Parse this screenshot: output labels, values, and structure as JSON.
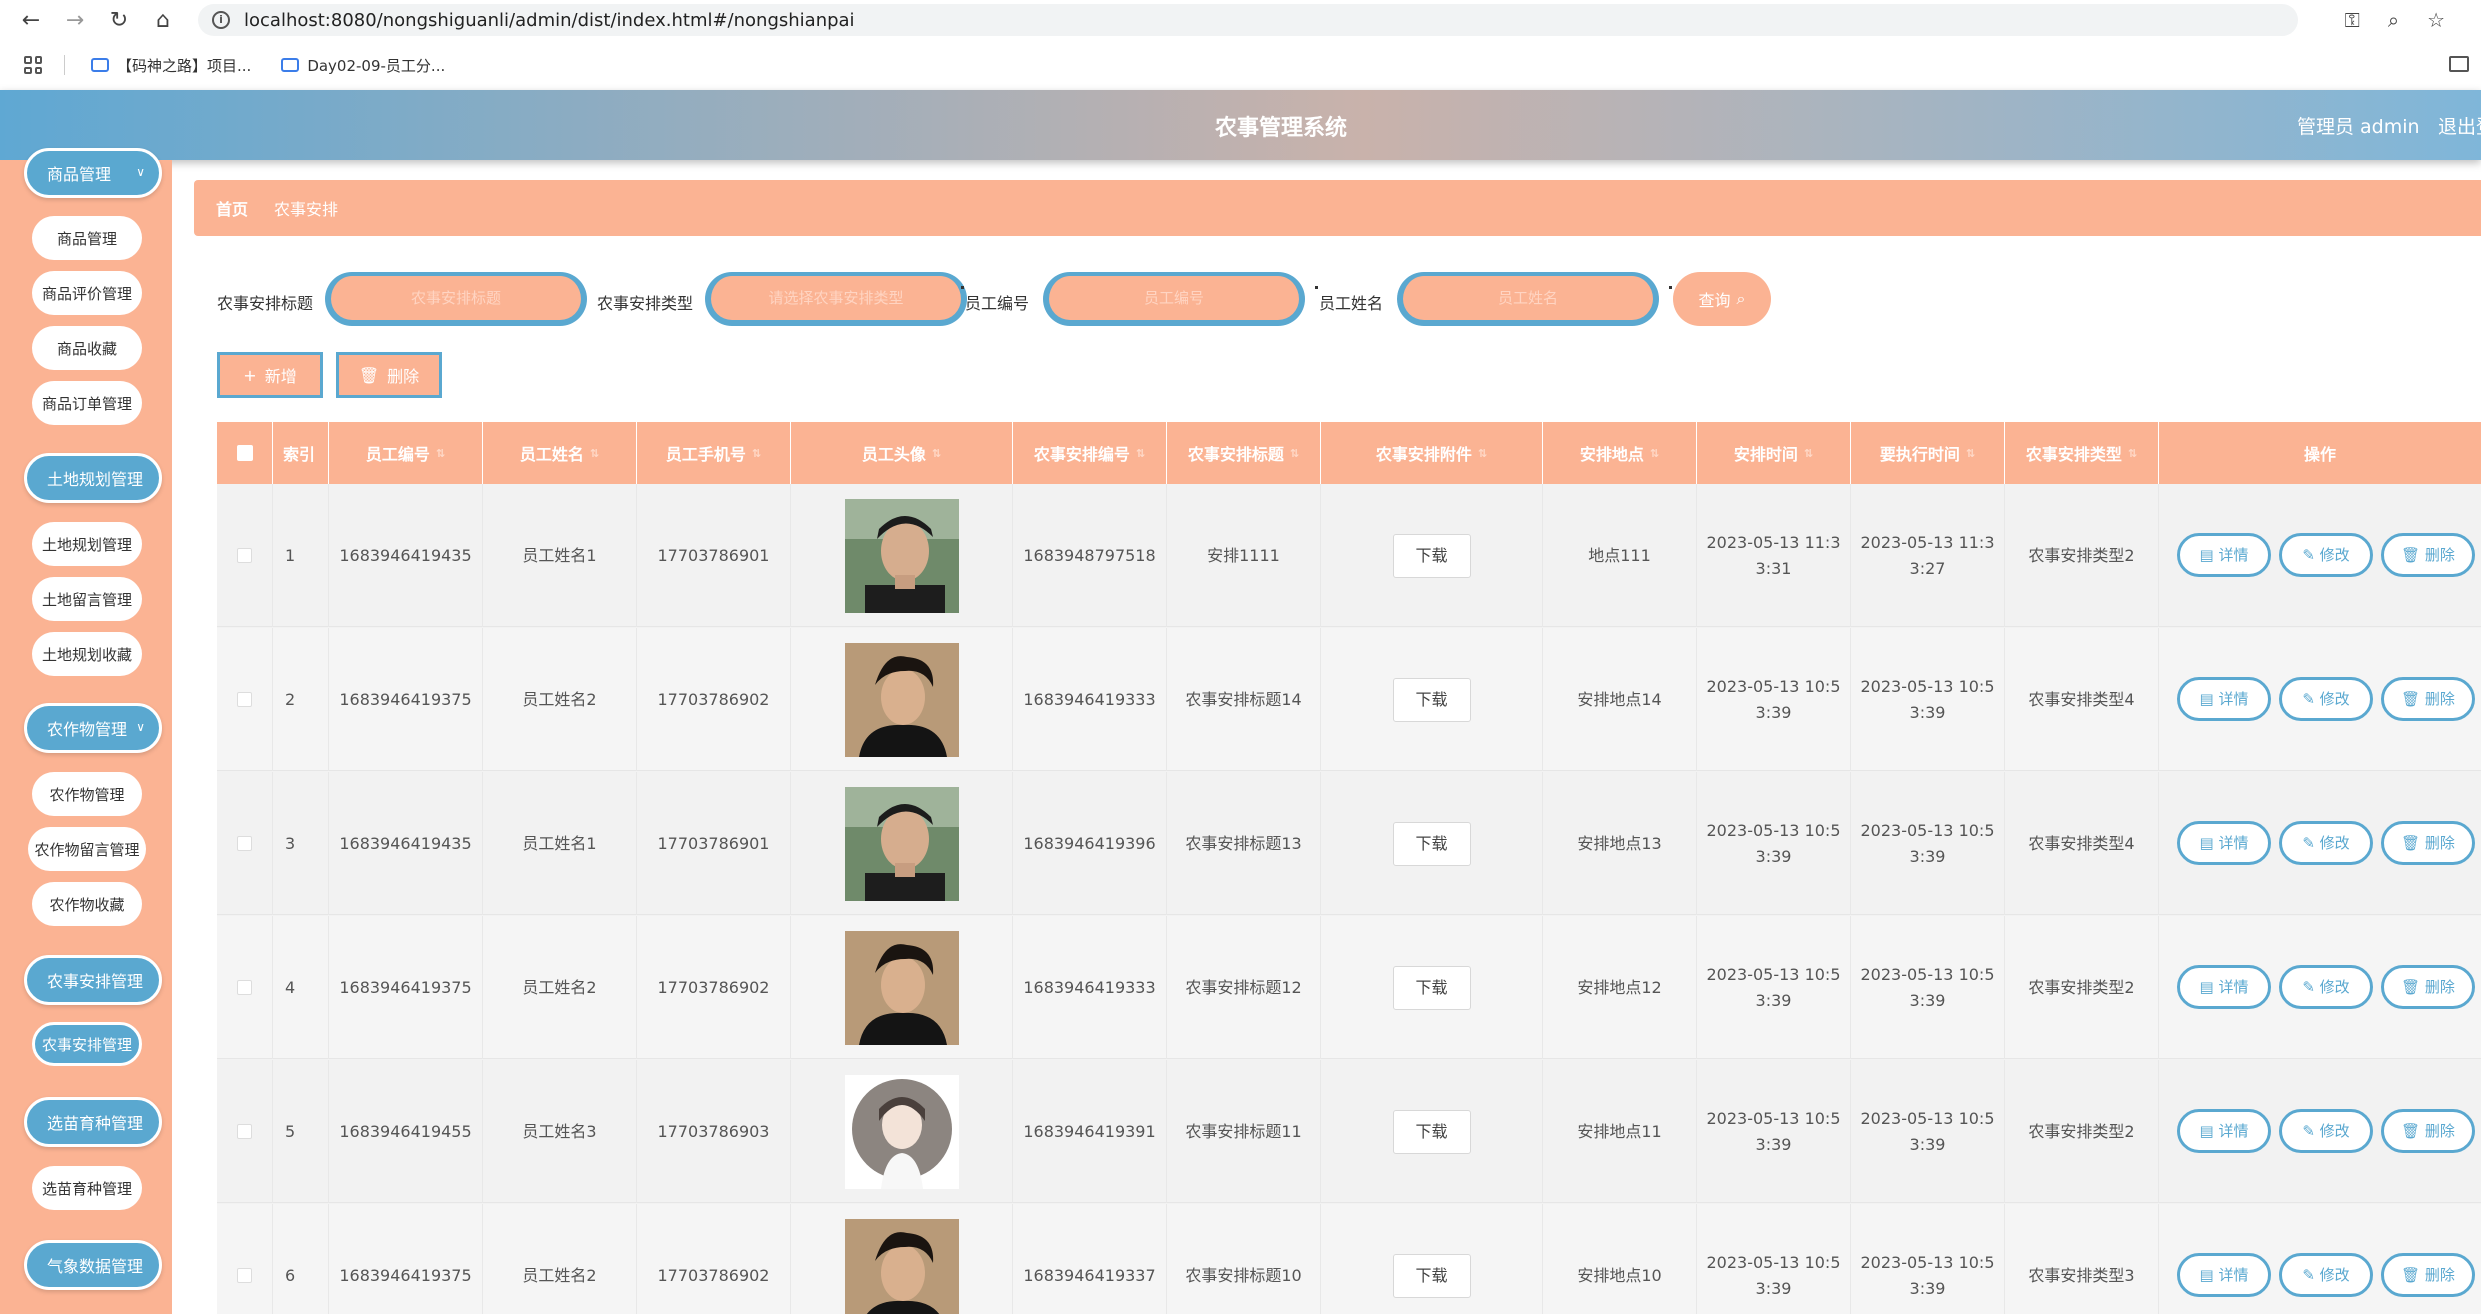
{
  "browser": {
    "url": "localhost:8080/nongshiguanli/admin/dist/index.html#/nongshianpai",
    "bookmarks": [
      "【码神之路】项目...",
      "Day02-09-员工分..."
    ]
  },
  "header": {
    "title": "农事管理系统",
    "admin": "管理员 admin",
    "logout": "退出登录"
  },
  "sidebar": {
    "groups": [
      {
        "label": "商品管理",
        "items": [
          "商品管理",
          "商品评价管理",
          "商品收藏",
          "商品订单管理"
        ]
      },
      {
        "label": "土地规划管理",
        "items": [
          "土地规划管理",
          "土地留言管理",
          "土地规划收藏"
        ]
      },
      {
        "label": "农作物管理",
        "items": [
          "农作物管理",
          "农作物留言管理",
          "农作物收藏"
        ]
      },
      {
        "label": "农事安排管理",
        "items": [
          "农事安排管理"
        ]
      },
      {
        "label": "选苗育种管理",
        "items": [
          "选苗育种管理"
        ]
      },
      {
        "label": "气象数据管理",
        "items": []
      }
    ]
  },
  "breadcrumb": {
    "home": "首页",
    "current": "农事安排"
  },
  "search": {
    "title_label": "农事安排标题",
    "title_placeholder": "农事安排标题",
    "type_label": "农事安排类型",
    "type_placeholder": "请选择农事安排类型",
    "empno_label": "员工编号",
    "empno_placeholder": "员工编号",
    "empname_label": "员工姓名",
    "empname_placeholder": "员工姓名",
    "query": "查询"
  },
  "actions": {
    "add": "新增",
    "delete": "删除"
  },
  "table": {
    "headers": [
      "索引",
      "员工编号",
      "员工姓名",
      "员工手机号",
      "员工头像",
      "农事安排编号",
      "农事安排标题",
      "农事安排附件",
      "安排地点",
      "安排时间",
      "要执行时间",
      "农事安排类型",
      "操作"
    ],
    "download": "下载",
    "ops": {
      "detail": "详情",
      "edit": "修改",
      "delete": "删除"
    },
    "rows": [
      {
        "index": "1",
        "empno": "1683946419435",
        "empname": "员工姓名1",
        "phone": "17703786901",
        "avatar": "male-a",
        "code": "1683948797518",
        "title": "安排1111",
        "place": "地点111",
        "time_a": "2023-05-13 11:3",
        "time_b": "3:31",
        "exec_a": "2023-05-13 11:3",
        "exec_b": "3:27",
        "type": "农事安排类型2"
      },
      {
        "index": "2",
        "empno": "1683946419375",
        "empname": "员工姓名2",
        "phone": "17703786902",
        "avatar": "male-b",
        "code": "1683946419333",
        "title": "农事安排标题14",
        "place": "安排地点14",
        "time_a": "2023-05-13 10:5",
        "time_b": "3:39",
        "exec_a": "2023-05-13 10:5",
        "exec_b": "3:39",
        "type": "农事安排类型4"
      },
      {
        "index": "3",
        "empno": "1683946419435",
        "empname": "员工姓名1",
        "phone": "17703786901",
        "avatar": "male-a",
        "code": "1683946419396",
        "title": "农事安排标题13",
        "place": "安排地点13",
        "time_a": "2023-05-13 10:5",
        "time_b": "3:39",
        "exec_a": "2023-05-13 10:5",
        "exec_b": "3:39",
        "type": "农事安排类型4"
      },
      {
        "index": "4",
        "empno": "1683946419375",
        "empname": "员工姓名2",
        "phone": "17703786902",
        "avatar": "male-b",
        "code": "1683946419333",
        "title": "农事安排标题12",
        "place": "安排地点12",
        "time_a": "2023-05-13 10:5",
        "time_b": "3:39",
        "exec_a": "2023-05-13 10:5",
        "exec_b": "3:39",
        "type": "农事安排类型2"
      },
      {
        "index": "5",
        "empno": "1683946419455",
        "empname": "员工姓名3",
        "phone": "17703786903",
        "avatar": "female",
        "code": "1683946419391",
        "title": "农事安排标题11",
        "place": "安排地点11",
        "time_a": "2023-05-13 10:5",
        "time_b": "3:39",
        "exec_a": "2023-05-13 10:5",
        "exec_b": "3:39",
        "type": "农事安排类型2"
      },
      {
        "index": "6",
        "empno": "1683946419375",
        "empname": "员工姓名2",
        "phone": "17703786902",
        "avatar": "male-b",
        "code": "1683946419337",
        "title": "农事安排标题10",
        "place": "安排地点10",
        "time_a": "2023-05-13 10:5",
        "time_b": "3:39",
        "exec_a": "2023-05-13 10:5",
        "exec_b": "3:39",
        "type": "农事安排类型3"
      }
    ]
  },
  "colors": {
    "accent": "#fbb393",
    "blue": "#5aa8d0"
  }
}
